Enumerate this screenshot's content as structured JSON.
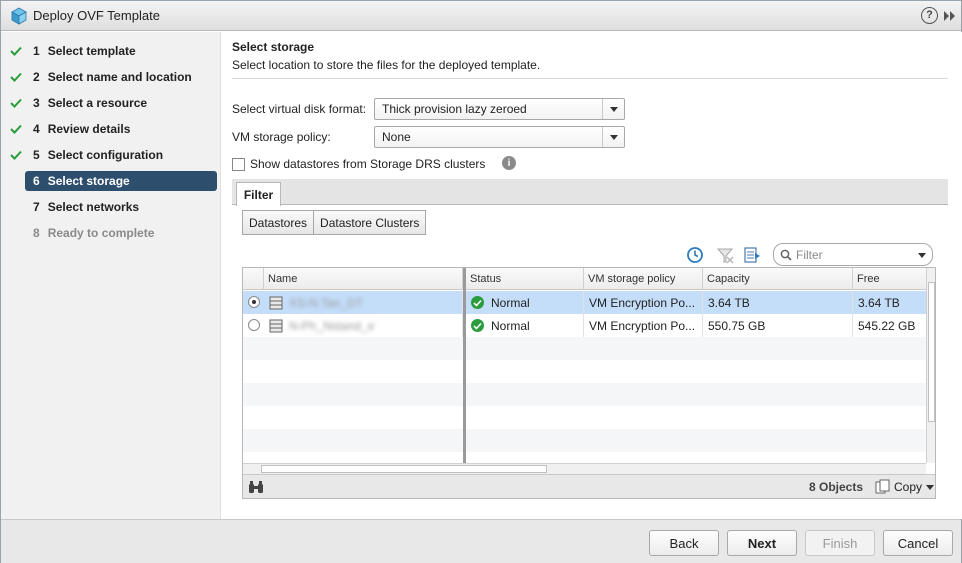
{
  "window": {
    "title": "Deploy OVF Template",
    "help_label": "?"
  },
  "steps": [
    {
      "num": "1",
      "label": "Select template",
      "status": "done"
    },
    {
      "num": "2",
      "label": "Select name and location",
      "status": "done"
    },
    {
      "num": "3",
      "label": "Select a resource",
      "status": "done"
    },
    {
      "num": "4",
      "label": "Review details",
      "status": "done"
    },
    {
      "num": "5",
      "label": "Select configuration",
      "status": "done"
    },
    {
      "num": "6",
      "label": "Select storage",
      "status": "active"
    },
    {
      "num": "7",
      "label": "Select networks",
      "status": "pending"
    },
    {
      "num": "8",
      "label": "Ready to complete",
      "status": "disabled"
    }
  ],
  "main": {
    "title": "Select storage",
    "description": "Select location to store the files for the deployed template.",
    "disk_format_label": "Select virtual disk format:",
    "disk_format_value": "Thick provision lazy zeroed",
    "policy_label": "VM storage policy:",
    "policy_value": "None",
    "show_drs_label": "Show datastores from Storage DRS clusters",
    "show_drs_checked": false,
    "info_label": "i"
  },
  "tabs": {
    "filter": "Filter"
  },
  "toggle": {
    "datastores": "Datastores",
    "clusters": "Datastore Clusters"
  },
  "filter": {
    "placeholder": "Filter"
  },
  "table": {
    "columns": [
      "Name",
      "Status",
      "VM storage policy",
      "Capacity",
      "Free"
    ],
    "rows": [
      {
        "name": "XS-N.Tan_DT",
        "status": "Normal",
        "policy": "VM Encryption Po...",
        "capacity": "3.64  TB",
        "free": "3.64  TB",
        "selected": true
      },
      {
        "name": "N-Ph_Nstand_e",
        "status": "Normal",
        "policy": "VM Encryption Po...",
        "capacity": "550.75  GB",
        "free": "545.22  GB",
        "selected": false
      }
    ],
    "object_count": "8 Objects",
    "copy_label": "Copy"
  },
  "buttons": {
    "back": "Back",
    "next": "Next",
    "finish": "Finish",
    "cancel": "Cancel"
  },
  "colors": {
    "active_step": "#2e4e6e",
    "selected_row": "#c4defa",
    "check_green": "#2a9c3c"
  }
}
